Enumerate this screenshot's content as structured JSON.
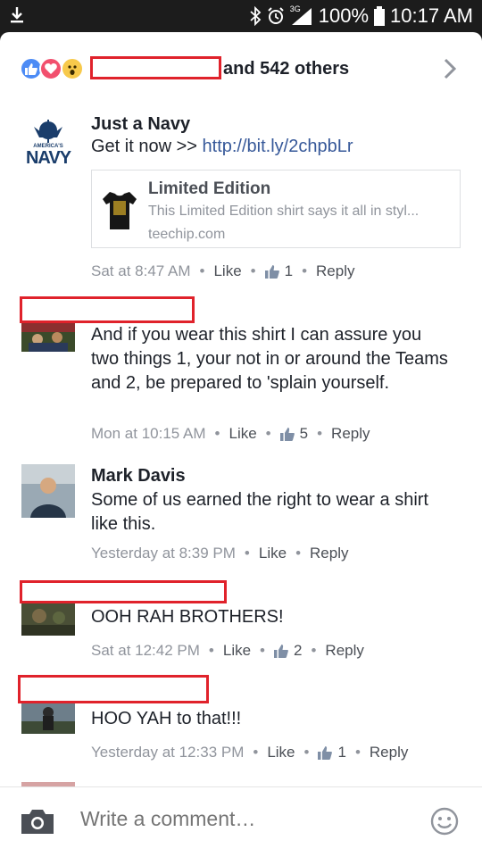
{
  "status_bar": {
    "battery": "100%",
    "time": "10:17 AM",
    "network": "3G",
    "icons": [
      "download-icon",
      "bluetooth-icon",
      "alarm-icon",
      "signal-icon",
      "battery-icon"
    ]
  },
  "reactions": {
    "types": [
      "like",
      "love",
      "wow"
    ],
    "summary": "and 542 others"
  },
  "comments": [
    {
      "author": "Just a Navy",
      "avatar_text_line1": "AMERICA'S",
      "avatar_text_line2": "NAVY",
      "text_prefix": "Get it now >> ",
      "link": "http://bit.ly/2chpbLr",
      "preview": {
        "title": "Limited Edition",
        "description": "This Limited Edition shirt says it all in styl...",
        "domain": "teechip.com"
      },
      "time": "Sat at 8:47 AM",
      "like_label": "Like",
      "like_count": "1",
      "reply_label": "Reply"
    },
    {
      "author": "",
      "text": "And if you wear this shirt I can assure you two things 1, your not in or around the Teams and 2, be prepared to 'splain yourself.",
      "time": "Mon at 10:15 AM",
      "like_label": "Like",
      "like_count": "5",
      "reply_label": "Reply"
    },
    {
      "author": "Mark Davis",
      "text": "Some of us earned the right to wear a shirt like this.",
      "time": "Yesterday at 8:39 PM",
      "like_label": "Like",
      "like_count": "",
      "reply_label": "Reply"
    },
    {
      "author": "",
      "text": "OOH RAH BROTHERS!",
      "time": "Sat at 12:42 PM",
      "like_label": "Like",
      "like_count": "2",
      "reply_label": "Reply"
    },
    {
      "author": "",
      "text": "HOO YAH to that!!!",
      "time": "Yesterday at 12:33 PM",
      "like_label": "Like",
      "like_count": "1",
      "reply_label": "Reply"
    }
  ],
  "composer": {
    "placeholder": "Write a comment…"
  },
  "colors": {
    "redaction": "#e0222b",
    "link": "#365899",
    "meta": "#90949c",
    "like_blue": "#4c8bf5"
  }
}
